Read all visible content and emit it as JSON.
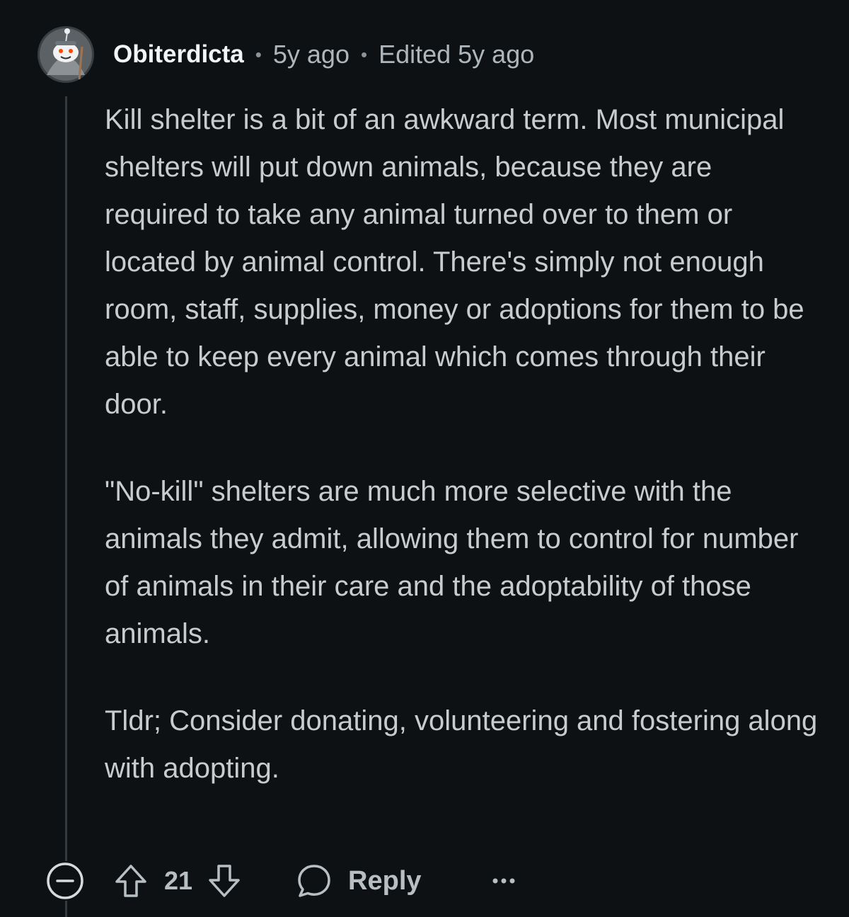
{
  "comment": {
    "author": "Obiterdicta",
    "separator": "•",
    "time_ago": "5y ago",
    "edited": "Edited 5y ago",
    "paragraphs": [
      "Kill shelter is a bit of an awkward term. Most municipal shelters will put down animals, because they are required to take any animal turned over to them or located by animal control. There's simply not enough room, staff, supplies, money or adoptions for them to be able to keep every animal which comes through their door.",
      "\"No-kill\" shelters are much more selective with the animals they admit, allowing them to control for number of animals in their care and the adoptability of those animals.",
      "Tldr; Consider donating, volunteering and fostering along with adopting."
    ]
  },
  "actions": {
    "vote_count": "21",
    "reply_label": "Reply",
    "icons": {
      "collapse": "minus-circle-icon",
      "upvote": "arrow-up-icon",
      "downvote": "arrow-down-icon",
      "reply": "speech-bubble-icon",
      "more": "ellipsis-icon"
    }
  },
  "colors": {
    "background": "#0e1113",
    "text": "#c8ccce",
    "meta": "#aeb6bb"
  }
}
